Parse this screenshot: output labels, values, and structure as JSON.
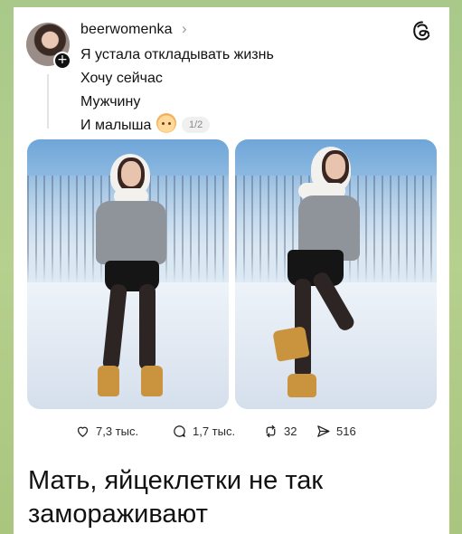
{
  "post": {
    "username": "beerwomenka",
    "lines": [
      "Я устала откладывать жизнь",
      "Хочу сейчас",
      "Мужчину",
      "И малыша"
    ],
    "pager": "1/2",
    "avatar_plus": "+"
  },
  "actions": {
    "likes": "7,3 тыс.",
    "comments": "1,7 тыс.",
    "reposts": "32",
    "shares": "516"
  },
  "caption": "Мать, яйцеклетки не так замораживают",
  "colors": {
    "background_green": "#9bc27a",
    "card": "#ffffff",
    "text": "#111111",
    "muted": "#8a8a8a"
  },
  "icons": {
    "chevron": "chevron-right-icon",
    "threads": "threads-logo-icon",
    "like": "heart-icon",
    "comment": "comment-bubble-icon",
    "repost": "repost-icon",
    "share": "send-icon"
  }
}
